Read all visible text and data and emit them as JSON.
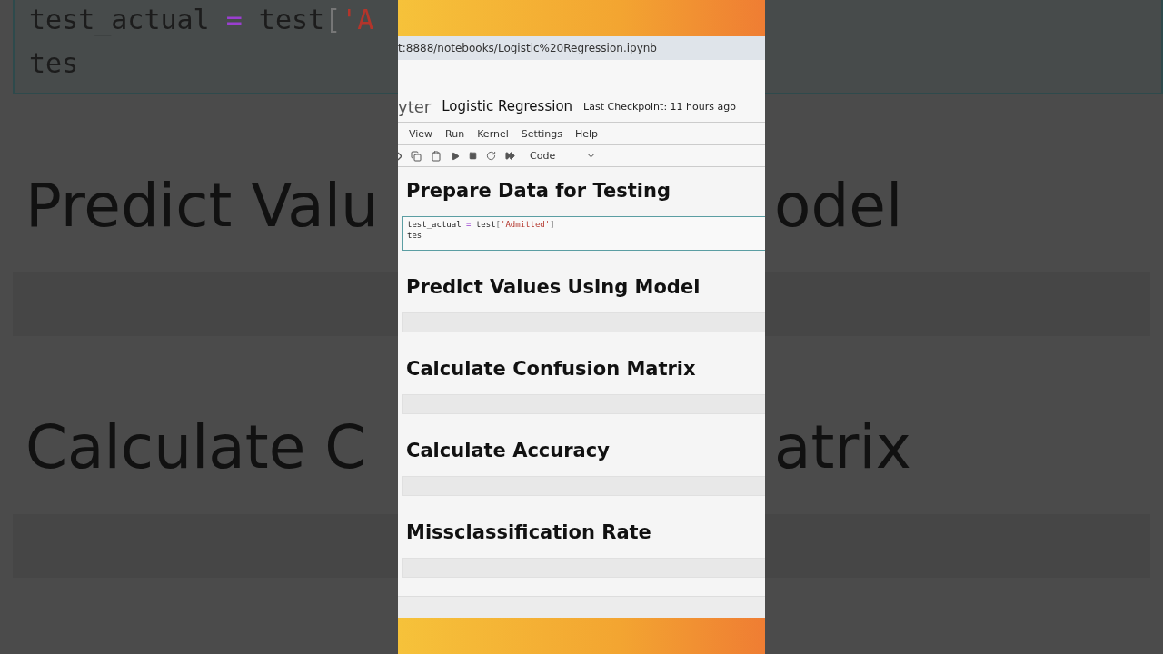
{
  "backdrop": {
    "left": {
      "code_lines": [
        [
          {
            "text": "test_actual ",
            "kind": "name"
          },
          {
            "text": "=",
            "kind": "operator"
          },
          {
            "text": " test",
            "kind": "name"
          },
          {
            "text": "[",
            "kind": "bracket"
          },
          {
            "text": "'A",
            "kind": "string"
          }
        ],
        [
          {
            "text": "tes",
            "kind": "name"
          }
        ]
      ],
      "headings": [
        "Predict Valu",
        "Calculate C"
      ]
    },
    "right": {
      "headings": [
        "odel",
        "atrix"
      ]
    }
  },
  "browser": {
    "url": "t:8888/notebooks/Logistic%20Regression.ipynb"
  },
  "app": {
    "logo_text": "yter",
    "notebook_title": "Logistic Regression",
    "checkpoint": "Last Checkpoint: 11 hours ago"
  },
  "menu": [
    "View",
    "Run",
    "Kernel",
    "Settings",
    "Help"
  ],
  "toolbar": {
    "cell_type": "Code"
  },
  "cells": [
    {
      "kind": "markdown",
      "text": "Prepare Data for Testing"
    },
    {
      "kind": "code",
      "active": true,
      "lines": [
        [
          {
            "text": "test_actual ",
            "kind": "name"
          },
          {
            "text": "=",
            "kind": "operator"
          },
          {
            "text": " test",
            "kind": "name"
          },
          {
            "text": "[",
            "kind": "bracket"
          },
          {
            "text": "'Admitted'",
            "kind": "string"
          },
          {
            "text": "]",
            "kind": "bracket"
          }
        ],
        [
          {
            "text": "tes",
            "kind": "name"
          }
        ]
      ]
    },
    {
      "kind": "markdown",
      "text": "Predict Values Using Model"
    },
    {
      "kind": "empty_code"
    },
    {
      "kind": "markdown",
      "text": "Calculate Confusion Matrix"
    },
    {
      "kind": "empty_code"
    },
    {
      "kind": "markdown",
      "text": "Calculate Accuracy"
    },
    {
      "kind": "empty_code"
    },
    {
      "kind": "markdown",
      "text": "Missclassification Rate"
    },
    {
      "kind": "empty_code"
    }
  ]
}
